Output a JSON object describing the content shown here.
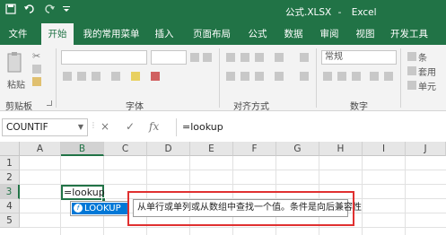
{
  "window": {
    "title": "公式.XLSX",
    "separator": "-",
    "app": "Excel"
  },
  "qat": {
    "save_icon": "save-icon",
    "undo_icon": "undo-icon",
    "redo_icon": "redo-icon"
  },
  "tabs": [
    {
      "label": "文件"
    },
    {
      "label": "开始"
    },
    {
      "label": "我的常用菜单"
    },
    {
      "label": "插入"
    },
    {
      "label": "页面布局"
    },
    {
      "label": "公式"
    },
    {
      "label": "数据"
    },
    {
      "label": "审阅"
    },
    {
      "label": "视图"
    },
    {
      "label": "开发工具"
    }
  ],
  "ribbon": {
    "clipboard": {
      "paste_label": "粘贴",
      "group_label": "剪贴板"
    },
    "font": {
      "group_label": "字体"
    },
    "alignment": {
      "group_label": "对齐方式"
    },
    "number": {
      "format_value": "常规",
      "group_label": "数字"
    },
    "styles": {
      "items": [
        "条",
        "套用",
        "单元"
      ]
    }
  },
  "formula_bar": {
    "name_box": "COUNTIF",
    "formula": "=lookup",
    "cancel": "×",
    "enter": "✓",
    "fx": "fx"
  },
  "grid": {
    "columns": [
      "A",
      "B",
      "C",
      "D",
      "E",
      "F",
      "G",
      "H",
      "I",
      "J"
    ],
    "rows": [
      "1",
      "2",
      "3",
      "4",
      "5"
    ],
    "active_cell_value": "=lookup"
  },
  "autocomplete": {
    "item": "LOOKUP",
    "tooltip": "从单行或单列或从数组中查找一个值。条件是向后兼容性"
  },
  "colors": {
    "accent": "#217346",
    "highlight": "#e03030",
    "selection": "#0078d7"
  }
}
